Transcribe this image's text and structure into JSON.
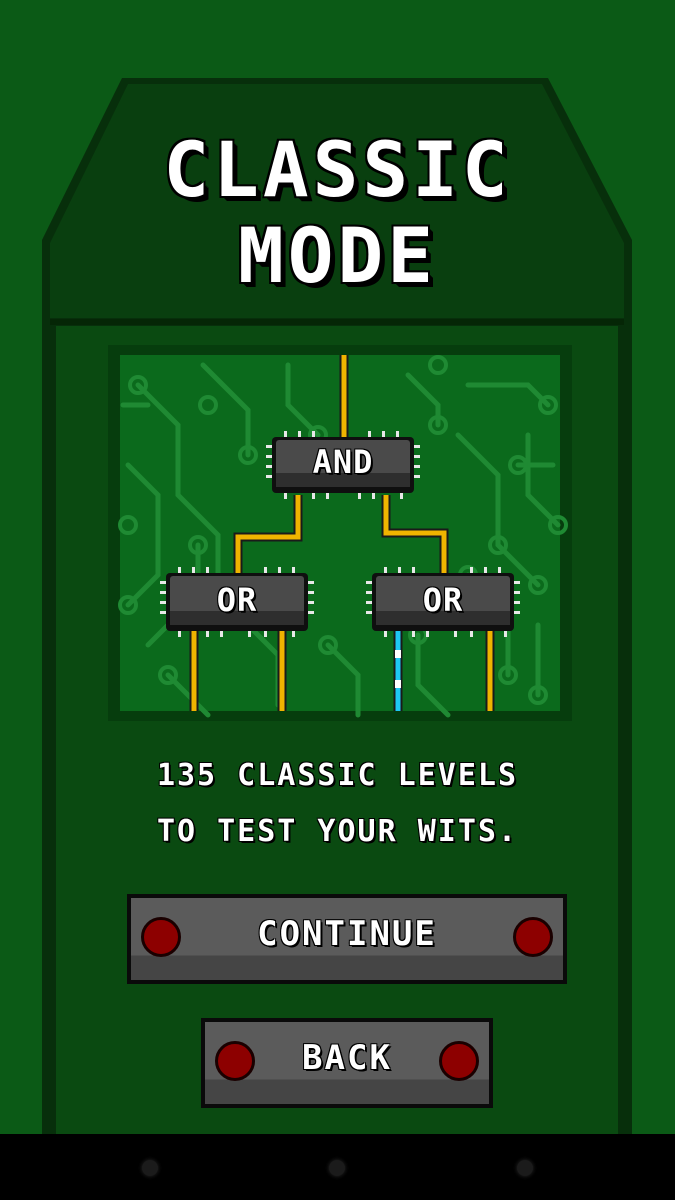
{
  "title": {
    "line1": "CLASSIC",
    "line2": "MODE"
  },
  "diagram": {
    "top_gate": "AND",
    "left_gate": "OR",
    "right_gate": "OR"
  },
  "description": {
    "line1": "135 CLASSIC LEVELS",
    "line2": "TO TEST YOUR WITS."
  },
  "buttons": {
    "continue_label": "CONTINUE",
    "back_label": "BACK"
  },
  "colors": {
    "background": "#0b5a16",
    "panel": "#0a4a11",
    "panel_header": "#093f0f",
    "board_trace": "#1f8a33",
    "wire_active": "#f0b400",
    "wire_signal": "#1ec8f5",
    "chip": "#3b3b3b",
    "lamp": "#8d0000"
  },
  "navigation_icons": [
    "nav-back-icon",
    "nav-home-icon",
    "nav-recents-icon"
  ]
}
